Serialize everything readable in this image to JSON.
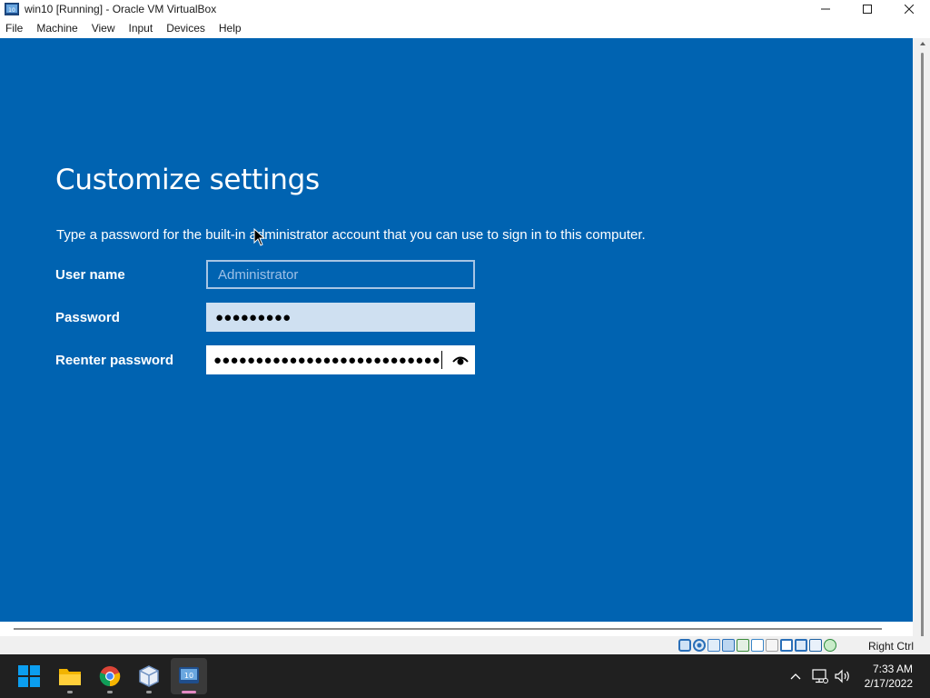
{
  "window": {
    "title": "win10 [Running] - Oracle VM VirtualBox",
    "controls": [
      "minimize",
      "maximize",
      "close"
    ]
  },
  "menu": {
    "items": [
      "File",
      "Machine",
      "View",
      "Input",
      "Devices",
      "Help"
    ]
  },
  "setup": {
    "heading": "Customize settings",
    "instruction": "Type a password for the built-in administrator account that you can use to sign in to this computer.",
    "username_label": "User name",
    "username_placeholder": "Administrator",
    "password_label": "Password",
    "password_value": "●●●●●●●●●",
    "reenter_label": "Reenter password",
    "reenter_value": "●●●●●●●●●●●●●●●●●●●●●●●●●●●",
    "background_color": "#0063b1"
  },
  "statusbar": {
    "icons": [
      "hard-disk-icon",
      "optical-disk-icon",
      "audio-icon",
      "network-icon",
      "usb-icon",
      "shared-folder-icon",
      "display-icon",
      "video-capture-icon",
      "virtualization-icon",
      "mouse-integration-icon",
      "host-key-arrow-icon"
    ],
    "host_key": "Right Ctrl"
  },
  "taskbar": {
    "apps": [
      "start-icon",
      "file-explorer-icon",
      "chrome-icon",
      "virtualbox-icon",
      "virtualbox-vm-icon"
    ],
    "active_app": "virtualbox-vm-icon",
    "tray": [
      "chevron-up-icon",
      "network-monitor-icon",
      "speaker-icon"
    ],
    "time": "7:33 AM",
    "date": "2/17/2022"
  }
}
